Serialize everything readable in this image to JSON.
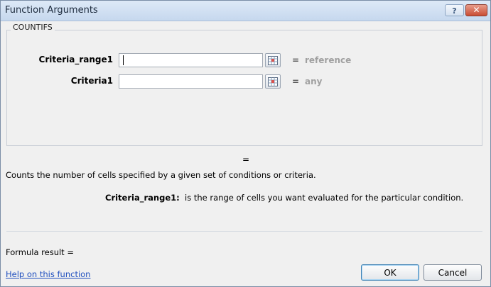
{
  "window": {
    "title": "Function Arguments",
    "help_button": "?",
    "close_button": "✕"
  },
  "function": {
    "name": "COUNTIFS"
  },
  "arguments": [
    {
      "label": "Criteria_range1",
      "value": "",
      "equals": "=",
      "hint": "reference"
    },
    {
      "label": "Criteria1",
      "value": "",
      "equals": "=",
      "hint": "any"
    }
  ],
  "result_equals": "=",
  "description": "Counts the number of cells specified by a given set of conditions or criteria.",
  "argument_help": {
    "name": "Criteria_range1:",
    "text": "is the range of cells you want evaluated for the particular condition."
  },
  "formula_result": "Formula result =",
  "help_link": "Help on this function",
  "buttons": {
    "ok": "OK",
    "cancel": "Cancel"
  },
  "colors": {
    "link": "#1f4fbf",
    "hint": "#a0a0a0",
    "close_button": "#c94d34"
  }
}
